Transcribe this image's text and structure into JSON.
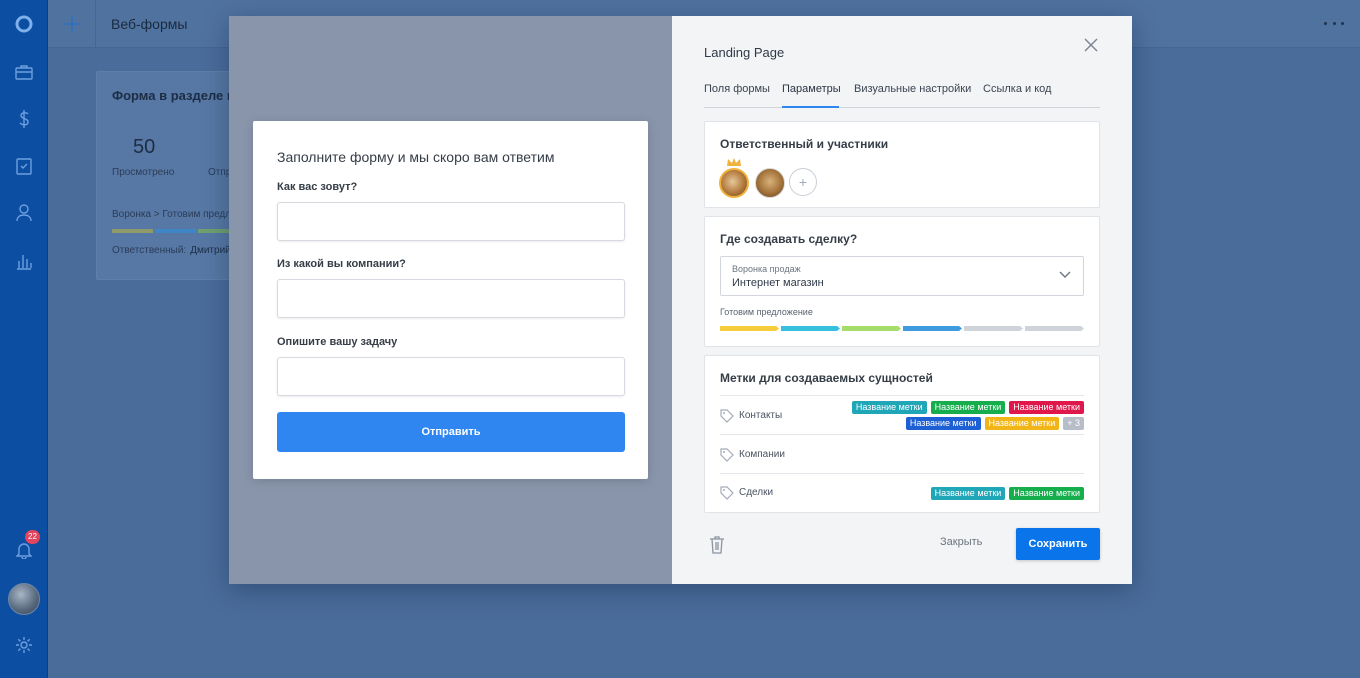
{
  "app": {
    "topbar_title": "Веб-формы"
  },
  "sidebar": {
    "notification_count": "22",
    "icons": [
      "logo-icon",
      "briefcase-icon",
      "dollar-icon",
      "clipboard-check-icon",
      "person-icon",
      "bar-chart-icon",
      "bell-icon",
      "gear-icon"
    ]
  },
  "background_card": {
    "title": "Форма в разделе кон",
    "stat_value": "50",
    "stat_label": "Просмотрено",
    "stat_label_2": "Отпр",
    "funnel_text": "Воронка > Готовим предло",
    "responsible_label": "Ответственный:",
    "responsible_value": "Дмитрий",
    "stage_colors": [
      "#8f9a6a",
      "#3f86c8",
      "#6fa070"
    ]
  },
  "preview_form": {
    "title": "Заполните форму и мы скоро вам ответим",
    "fields": [
      {
        "label": "Как вас зовут?",
        "value": ""
      },
      {
        "label": "Из какой вы компании?",
        "value": ""
      },
      {
        "label": "Опишите вашу задачу",
        "value": ""
      }
    ],
    "submit_label": "Отправить"
  },
  "panel": {
    "title": "Landing Page",
    "tabs": [
      {
        "label": "Поля формы",
        "active": false
      },
      {
        "label": "Параметры",
        "active": true
      },
      {
        "label": "Визуальные настройки",
        "active": false
      },
      {
        "label": "Ссылка и код",
        "active": false
      }
    ],
    "responsible_section": {
      "title": "Ответственный и участники",
      "add_label": "+"
    },
    "deal_section": {
      "title": "Где создавать сделку?",
      "select_label": "Воронка продаж",
      "select_value": "Интернет магазин",
      "stage_label": "Готовим предложение",
      "stage_colors": [
        "#f5cd3b",
        "#35c0de",
        "#a6dc6a",
        "#3e9be0",
        "#cfd4db",
        "#cfd4db"
      ]
    },
    "tags_section": {
      "title": "Метки для создаваемых сущностей",
      "rows": [
        {
          "label": "Контакты",
          "chips": [
            {
              "text": "Название метки",
              "color": "#1fa7b8"
            },
            {
              "text": "Название метки",
              "color": "#16ae4d"
            },
            {
              "text": "Название метки",
              "color": "#e0174a"
            },
            {
              "text": "Название метки",
              "color": "#1d5fd4"
            },
            {
              "text": "Название метки",
              "color": "#f2b518"
            }
          ],
          "more": "+ 3"
        },
        {
          "label": "Компании",
          "chips": [],
          "more": ""
        },
        {
          "label": "Сделки",
          "chips": [
            {
              "text": "Название метки",
              "color": "#1fa7b8"
            },
            {
              "text": "Название метки",
              "color": "#16ae4d"
            }
          ],
          "more": ""
        }
      ]
    },
    "footer": {
      "close_label": "Закрыть",
      "save_label": "Сохранить"
    }
  }
}
